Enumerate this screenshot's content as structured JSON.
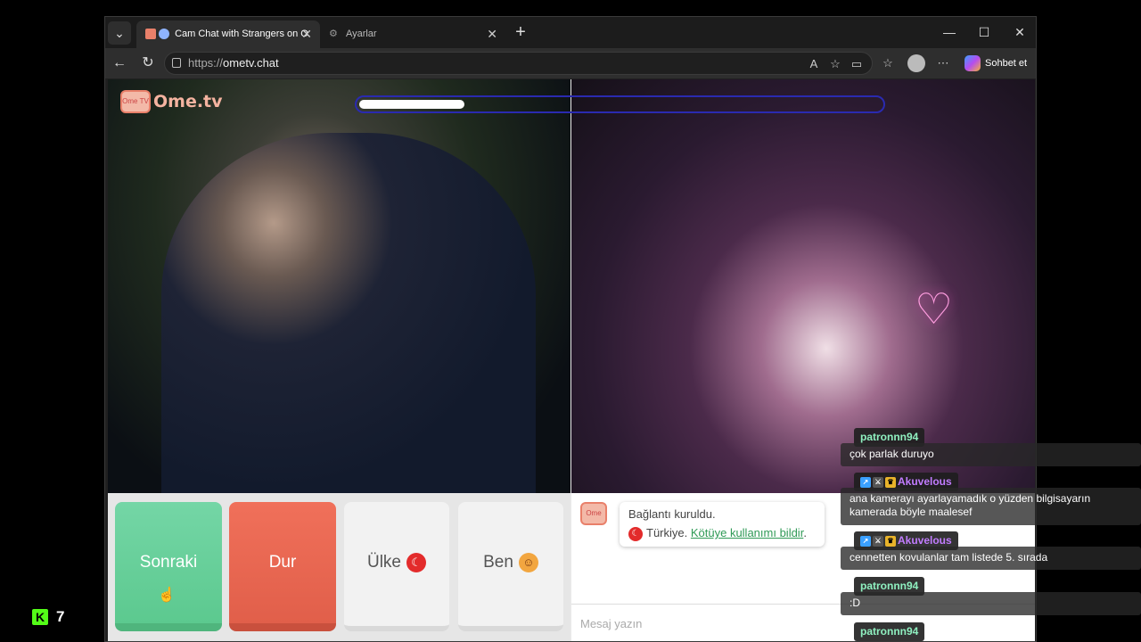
{
  "browser": {
    "tabs": [
      {
        "title": "Cam Chat with Strangers on O",
        "active": true
      },
      {
        "title": "Ayarlar",
        "active": false
      }
    ],
    "url_protocol": "https://",
    "url_host": "ometv.chat",
    "copilot_label": "Sohbet et"
  },
  "site": {
    "logo_text": "Ome.tv",
    "logo_badge": "Ome TV",
    "connection_progress": 0.2
  },
  "controls": {
    "next_label": "Sonraki",
    "stop_label": "Dur",
    "country_label": "Ülke",
    "me_label": "Ben"
  },
  "chat": {
    "system_line1": "Bağlantı kuruldu.",
    "system_country": "Türkiye.",
    "system_report": "Kötüye kullanımı bildir",
    "system_period": ".",
    "input_placeholder": "Mesaj yazın"
  },
  "stream_chat": [
    {
      "user": "patronnn94",
      "color": "green",
      "message": "çok parlak duruyo"
    },
    {
      "user": "Akuvelous",
      "color": "purple",
      "message": "ana kamerayı ayarlayamadık o yüzden bilgisayarın kamerada böyle maalesef"
    },
    {
      "user": "Akuvelous",
      "color": "purple",
      "message": "cennetten kovulanlar tam listede 5. sırada"
    },
    {
      "user": "patronnn94",
      "color": "green",
      "message": ":D"
    },
    {
      "user": "patronnn94",
      "color": "green",
      "message": ""
    }
  ],
  "kick": {
    "viewer_count": "7"
  },
  "colors": {
    "next_green": "#5cc98f",
    "stop_red": "#e15f4a",
    "link_green": "#2f9a56",
    "kick_green": "#53fc18"
  }
}
